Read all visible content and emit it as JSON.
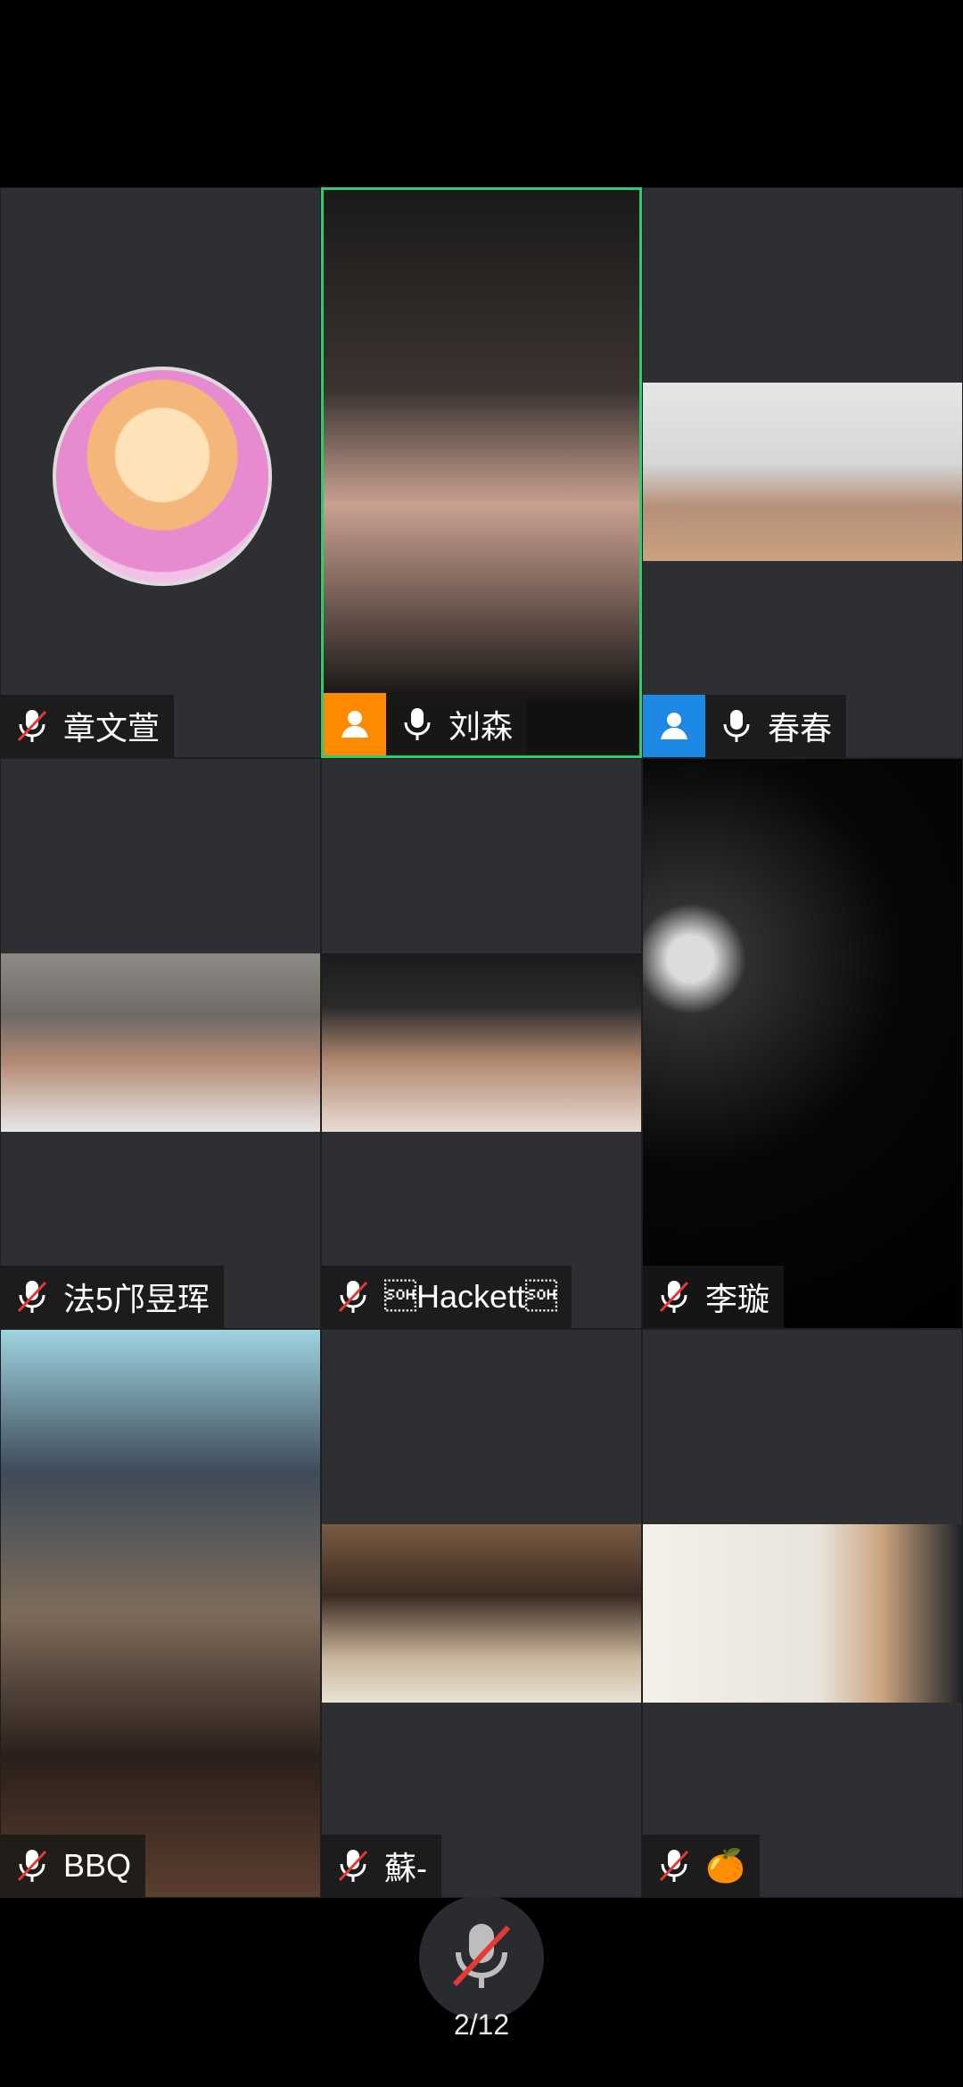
{
  "participants": [
    {
      "name": "章文萱",
      "mic": "muted",
      "video": "avatar",
      "badge": "none"
    },
    {
      "name": "刘森",
      "mic": "on",
      "video": "camera",
      "badge": "orange"
    },
    {
      "name": "春春",
      "mic": "on",
      "video": "camera",
      "badge": "blue"
    },
    {
      "name": "法5邝昱珲",
      "mic": "muted",
      "video": "camera",
      "badge": "none"
    },
    {
      "name": "\u0001Hackett\u0001",
      "mic": "muted",
      "video": "camera",
      "badge": "none"
    },
    {
      "name": "李璇",
      "mic": "muted",
      "video": "camera",
      "badge": "none"
    },
    {
      "name": "BBQ",
      "mic": "muted",
      "video": "camera",
      "badge": "none"
    },
    {
      "name": "蘇-",
      "mic": "muted",
      "video": "camera",
      "badge": "none"
    },
    {
      "name": "🍊",
      "mic": "muted",
      "video": "camera",
      "badge": "none"
    }
  ],
  "controls": {
    "mic_button_icon": "mic-muted-icon",
    "page_indicator": "2/12"
  },
  "colors": {
    "active_speaker_border": "#2ecc71",
    "badge_orange": "#ff8a00",
    "badge_blue": "#1e88e5",
    "tile_bg": "#2e2f32"
  }
}
